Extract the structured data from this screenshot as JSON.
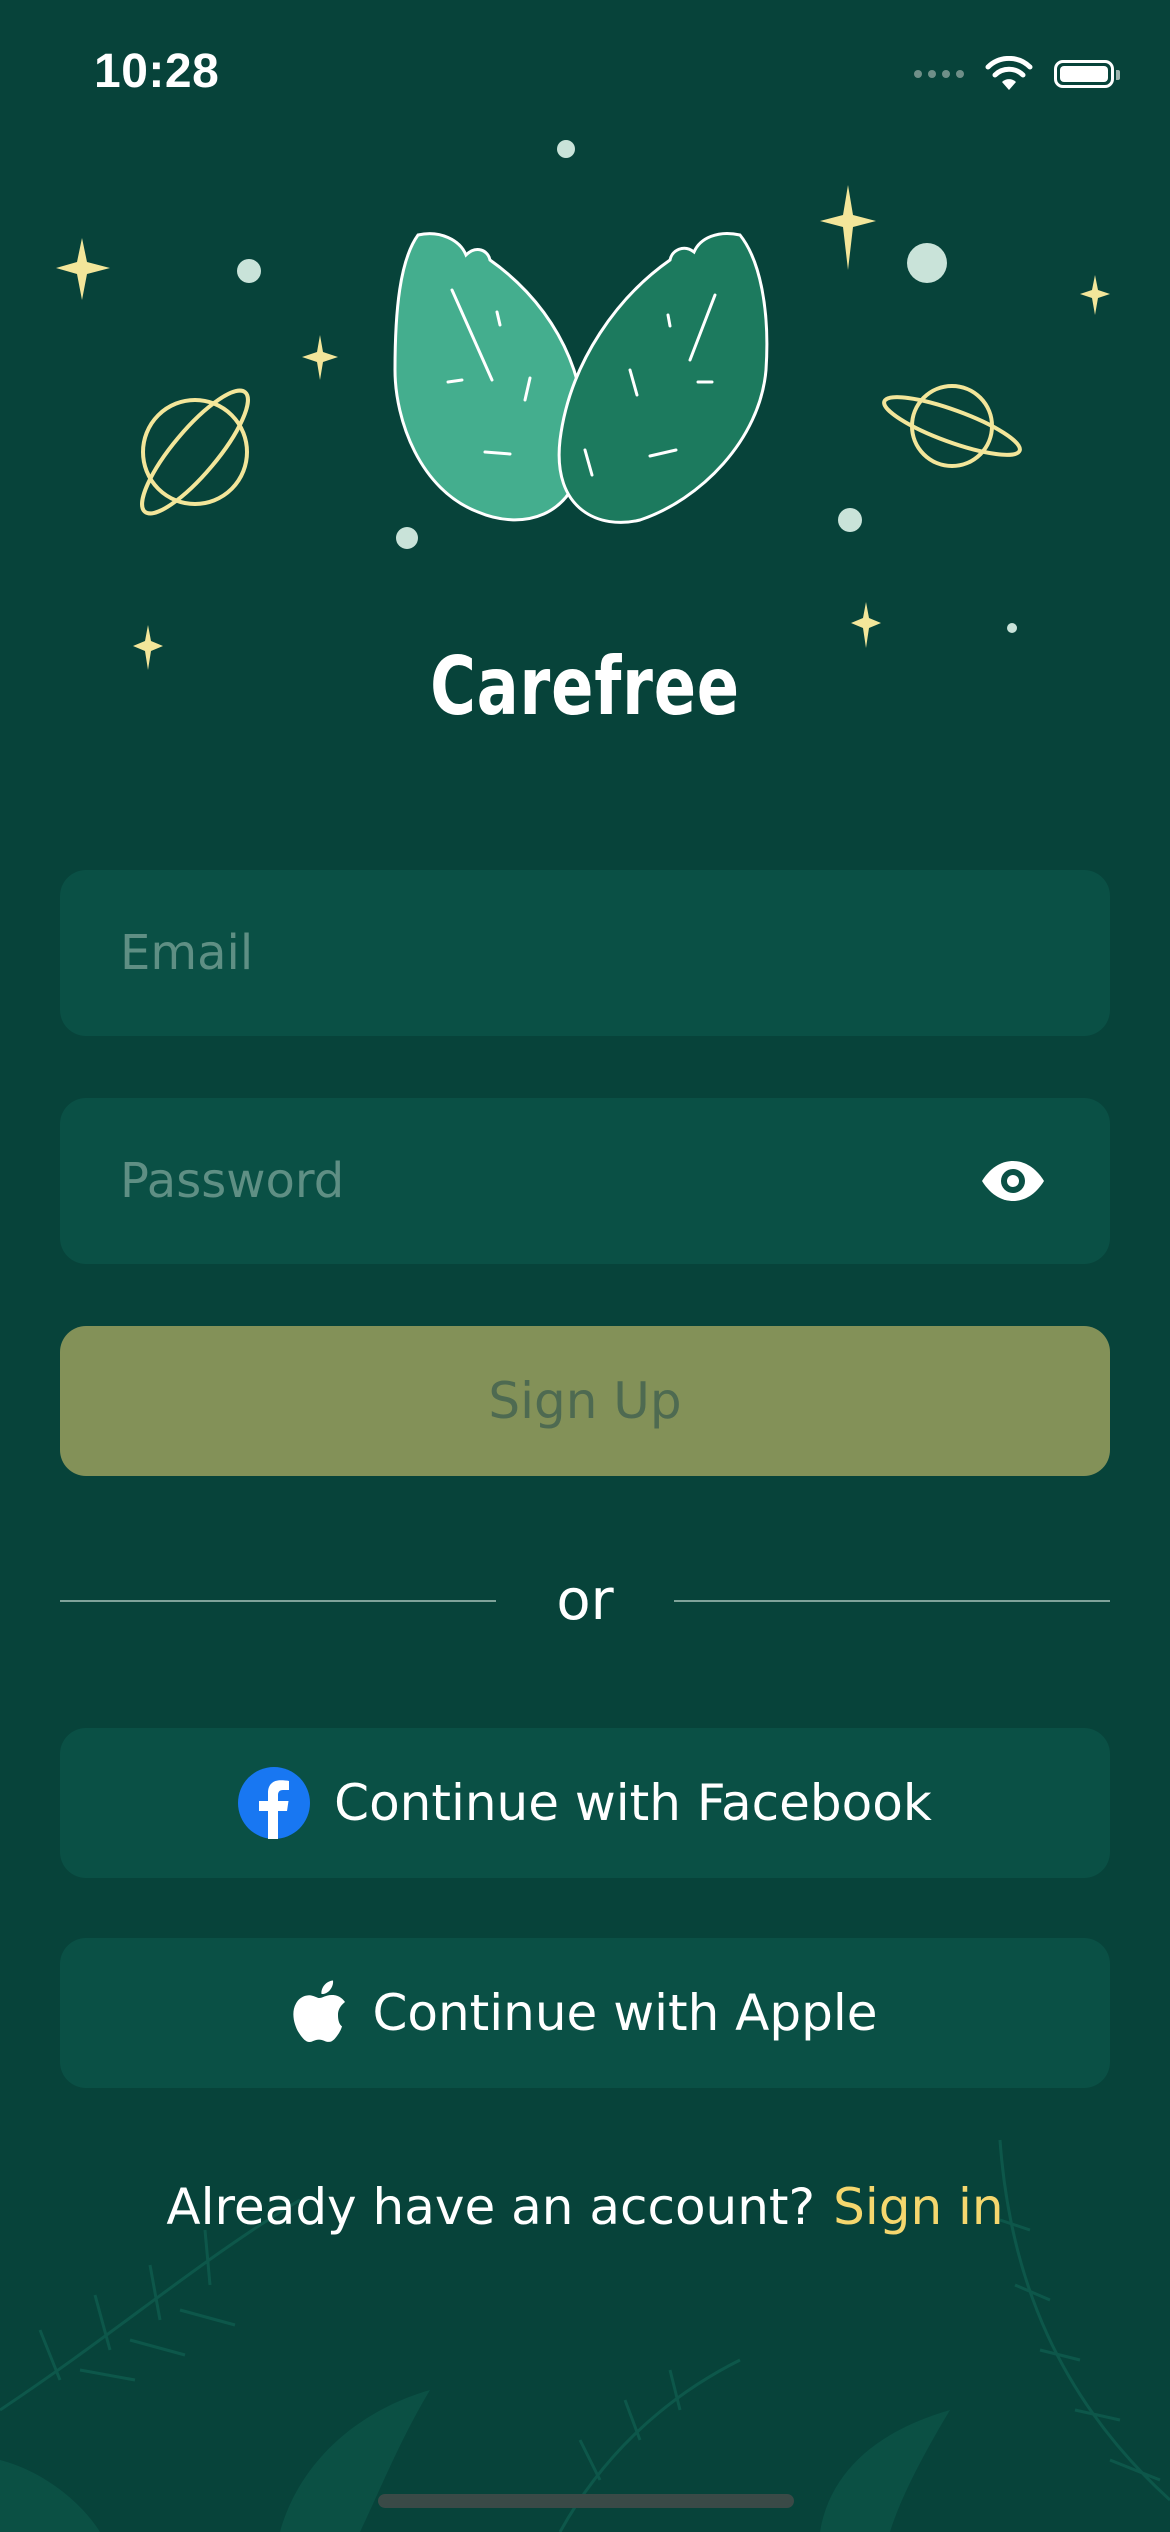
{
  "status_bar": {
    "time": "10:28"
  },
  "app": {
    "name": "Carefree"
  },
  "form": {
    "email_placeholder": "Email",
    "password_placeholder": "Password",
    "signup_label": "Sign Up"
  },
  "divider": {
    "label": "or"
  },
  "social": {
    "facebook_label": "Continue with Facebook",
    "apple_label": "Continue with Apple"
  },
  "footer": {
    "prompt": "Already have an account?",
    "signin_label": "Sign in"
  },
  "colors": {
    "background": "#07433a",
    "field": "#0a5045",
    "primary_button": "#839158",
    "accent_link": "#f5d76e",
    "facebook_blue": "#1877f2"
  },
  "icons": [
    "wifi-icon",
    "battery-icon",
    "eye-icon",
    "facebook-icon",
    "apple-icon",
    "leaves-logo-icon",
    "planet-icon",
    "sparkle-icon"
  ]
}
